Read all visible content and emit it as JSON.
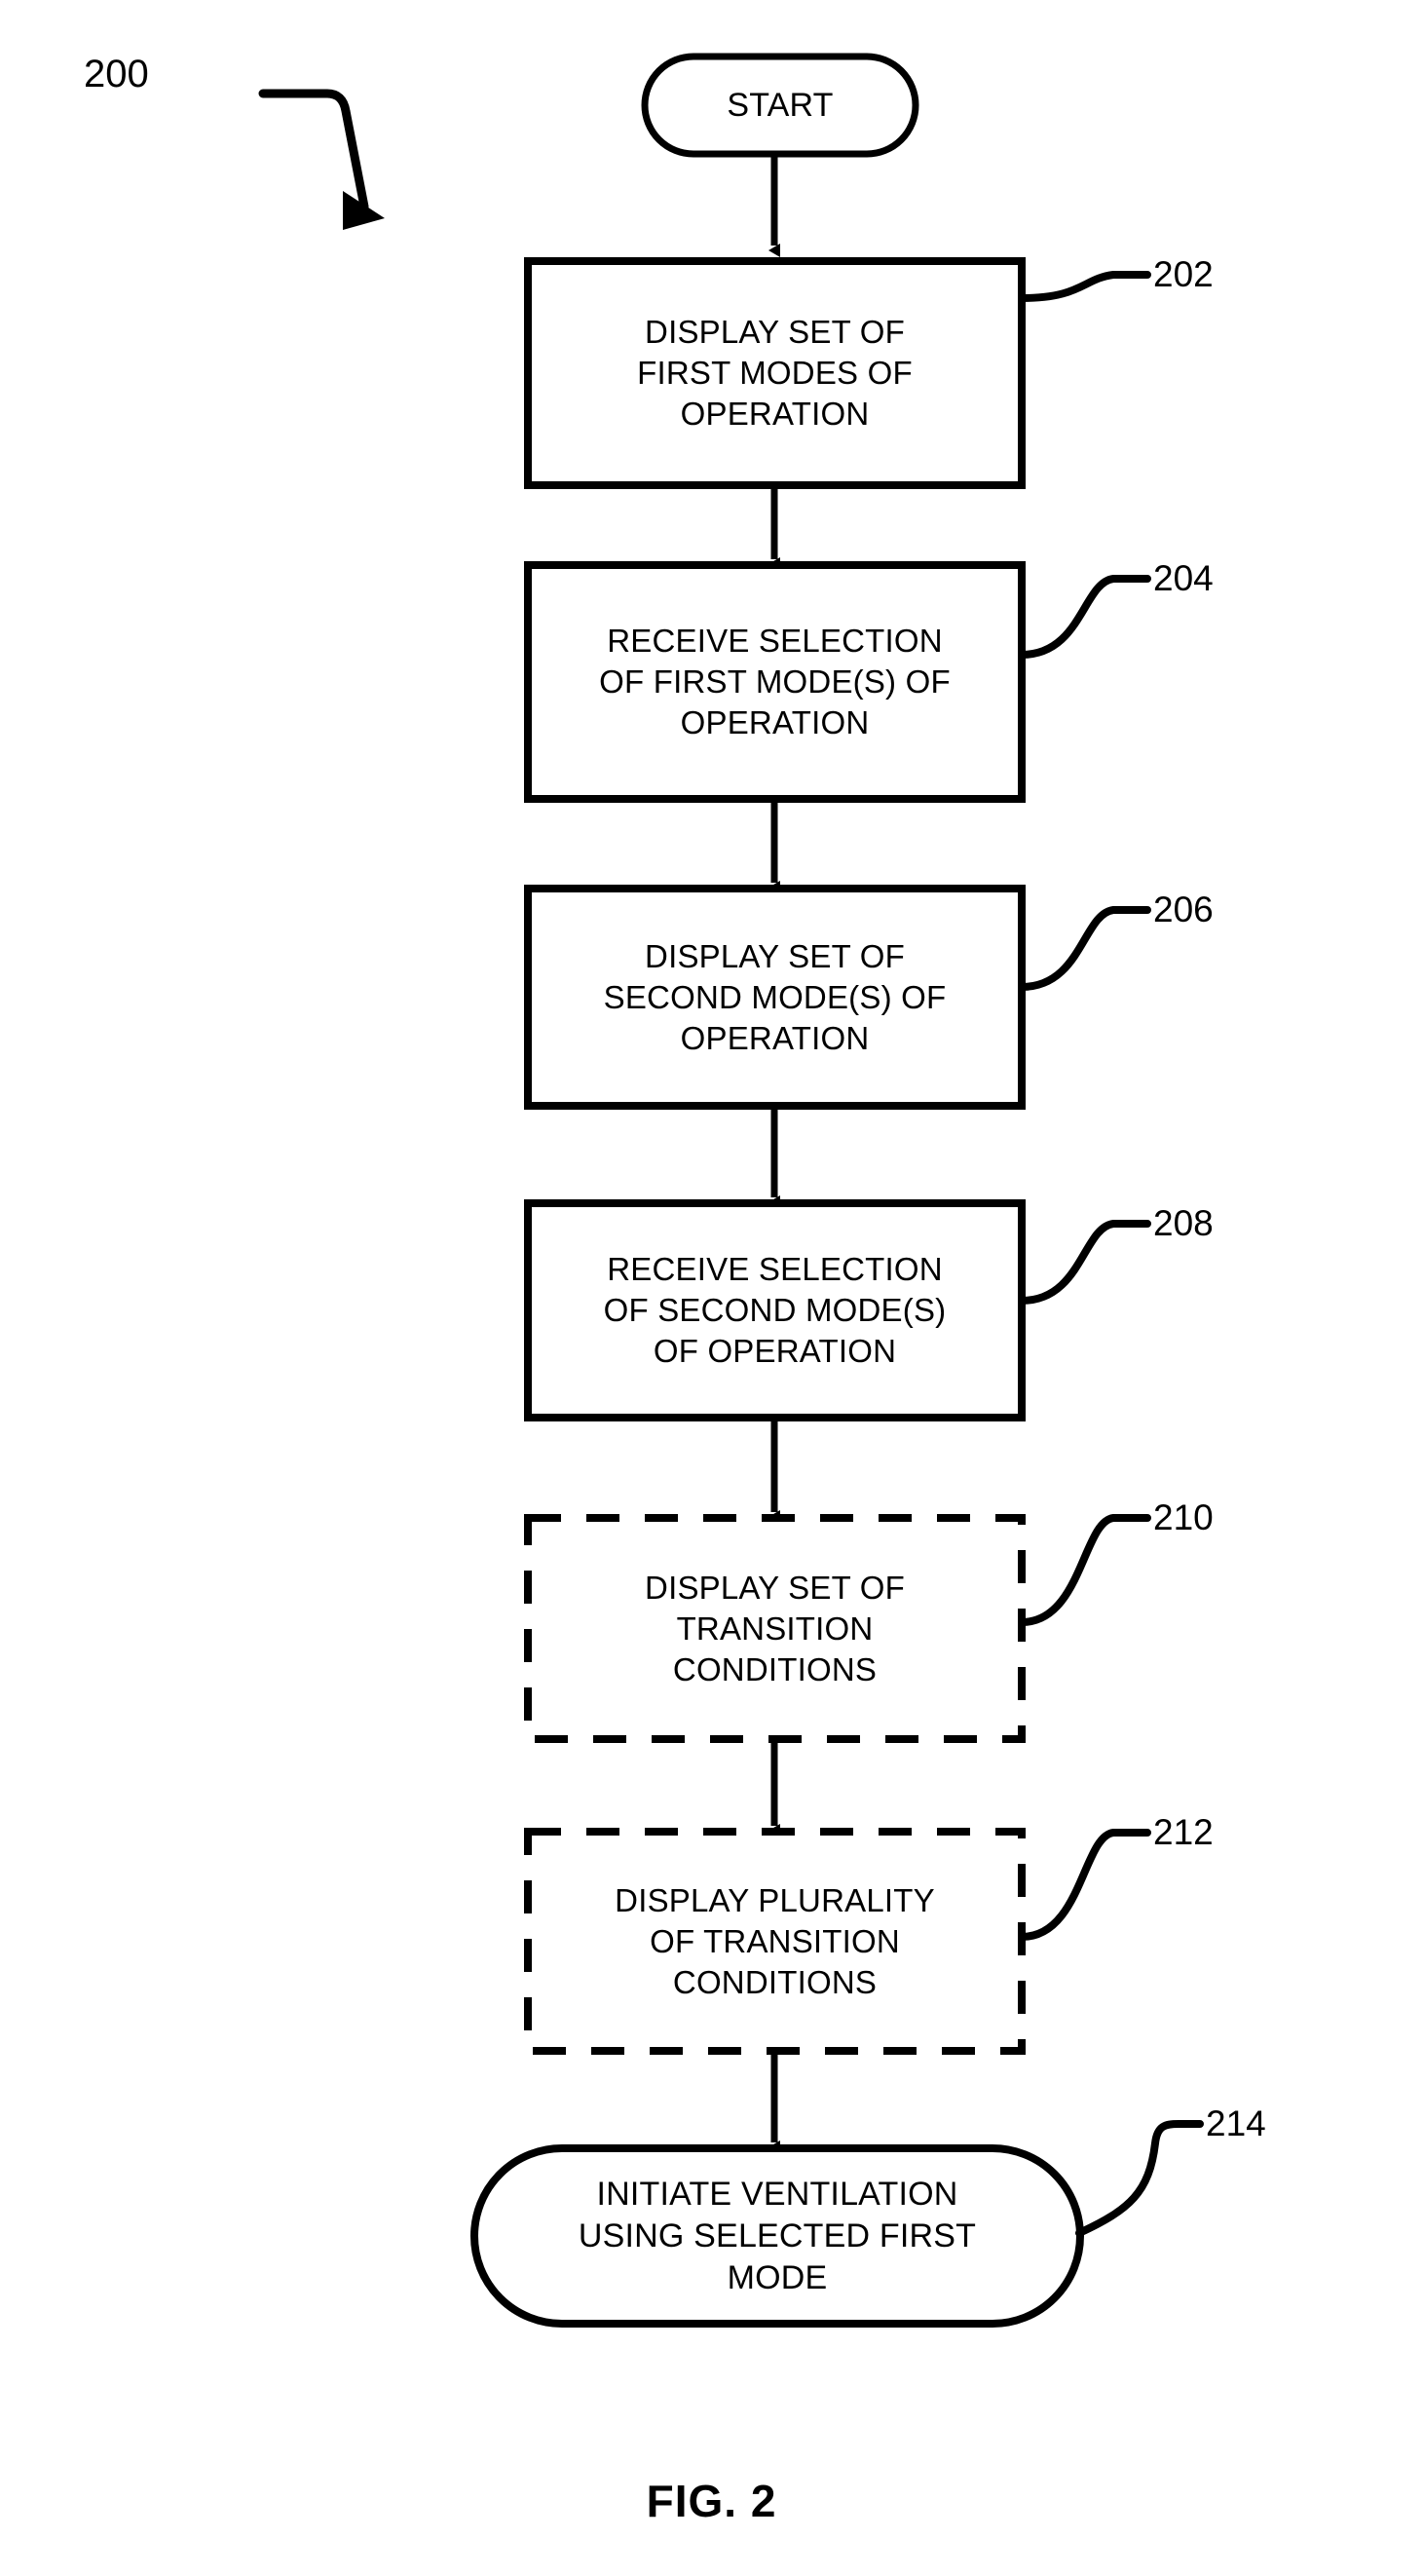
{
  "figure": {
    "caption": "FIG. 2",
    "figure_ref_label": "200",
    "background_color": "#ffffff",
    "stroke_color": "#000000"
  },
  "flowchart": {
    "nodes": [
      {
        "id": "start",
        "shape": "terminator",
        "border": "solid",
        "ref": null,
        "lines": [
          "START"
        ]
      },
      {
        "id": "step202",
        "shape": "process",
        "border": "solid",
        "ref": "202",
        "lines": [
          "DISPLAY SET OF",
          "FIRST MODES OF",
          "OPERATION"
        ]
      },
      {
        "id": "step204",
        "shape": "process",
        "border": "solid",
        "ref": "204",
        "lines": [
          "RECEIVE SELECTION",
          "OF FIRST MODE(S) OF",
          "OPERATION"
        ]
      },
      {
        "id": "step206",
        "shape": "process",
        "border": "solid",
        "ref": "206",
        "lines": [
          "DISPLAY SET OF",
          "SECOND MODE(S) OF",
          "OPERATION"
        ]
      },
      {
        "id": "step208",
        "shape": "process",
        "border": "solid",
        "ref": "208",
        "lines": [
          "RECEIVE SELECTION",
          "OF SECOND MODE(S)",
          "OF OPERATION"
        ]
      },
      {
        "id": "step210",
        "shape": "process",
        "border": "dashed",
        "ref": "210",
        "lines": [
          "DISPLAY SET OF",
          "TRANSITION",
          "CONDITIONS"
        ]
      },
      {
        "id": "step212",
        "shape": "process",
        "border": "dashed",
        "ref": "212",
        "lines": [
          "DISPLAY PLURALITY",
          "OF TRANSITION",
          "CONDITIONS"
        ]
      },
      {
        "id": "step214",
        "shape": "terminator",
        "border": "solid",
        "ref": "214",
        "lines": [
          "INITIATE VENTILATION",
          "USING SELECTED FIRST",
          "MODE"
        ]
      }
    ],
    "edges": [
      {
        "from": "start",
        "to": "step202",
        "arrow": true
      },
      {
        "from": "step202",
        "to": "step204",
        "arrow": true
      },
      {
        "from": "step204",
        "to": "step206",
        "arrow": true
      },
      {
        "from": "step206",
        "to": "step208",
        "arrow": true
      },
      {
        "from": "step208",
        "to": "step210",
        "arrow": true
      },
      {
        "from": "step210",
        "to": "step212",
        "arrow": true
      },
      {
        "from": "step212",
        "to": "step214",
        "arrow": true
      }
    ]
  }
}
